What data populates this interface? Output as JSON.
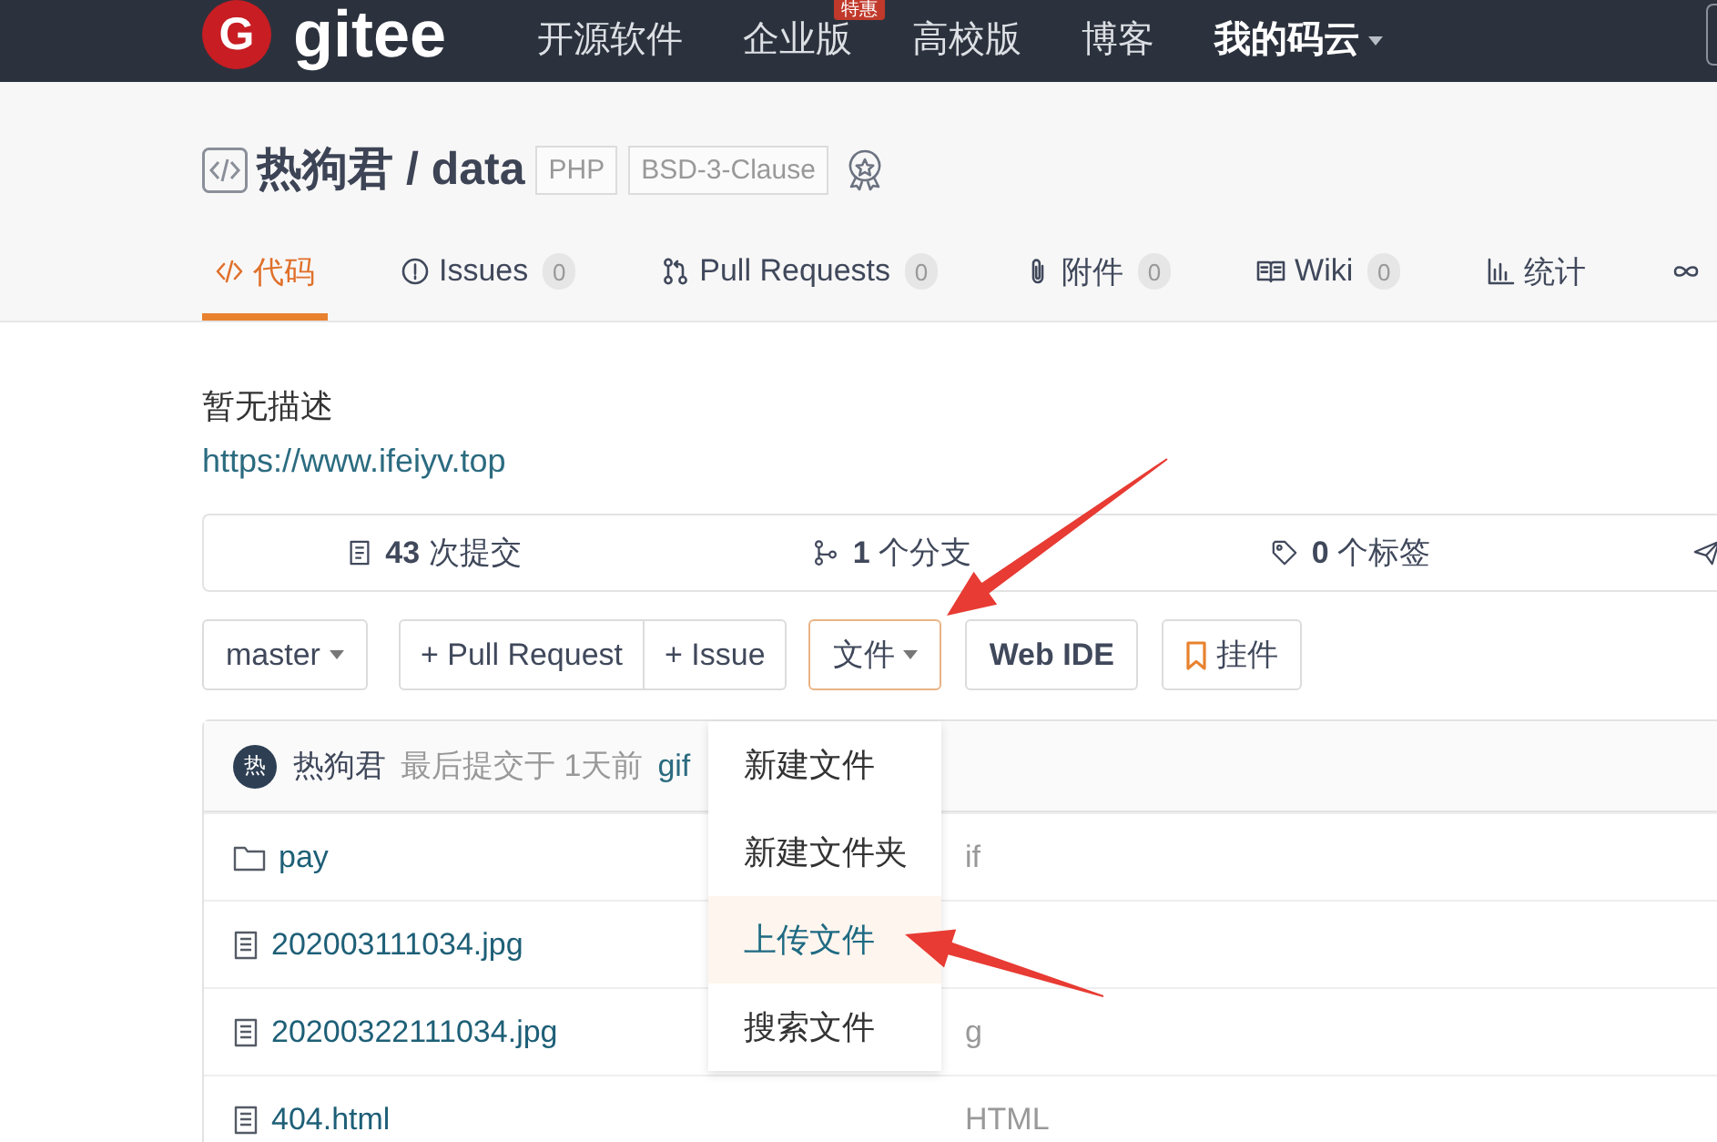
{
  "navbar": {
    "logo": {
      "mark": "G",
      "text": "gitee"
    },
    "items": [
      {
        "label": "开源软件",
        "kind": "link"
      },
      {
        "label": "企业版",
        "kind": "link",
        "badge": "特惠"
      },
      {
        "label": "高校版",
        "kind": "link"
      },
      {
        "label": "博客",
        "kind": "link"
      },
      {
        "label": "我的码云",
        "kind": "menu"
      }
    ]
  },
  "repo": {
    "title": "热狗君 / data",
    "tags": [
      "PHP",
      "BSD-3-Clause"
    ]
  },
  "tabs": [
    {
      "kind": "code",
      "label": "代码",
      "selected": true
    },
    {
      "kind": "issue",
      "label": "Issues",
      "count": "0",
      "selected": false
    },
    {
      "kind": "pull",
      "label": "Pull Requests",
      "count": "0",
      "selected": false
    },
    {
      "kind": "attach",
      "label": "附件",
      "count": "0",
      "selected": false
    },
    {
      "kind": "wiki",
      "label": "Wiki",
      "count": "0",
      "selected": false
    },
    {
      "kind": "chart",
      "label": "统计",
      "selected": false
    },
    {
      "kind": "service",
      "selected": false
    }
  ],
  "description": "暂无描述",
  "homepage": "https://www.ifeiyv.top",
  "stats": [
    {
      "kind": "commit",
      "count": "43",
      "label": "次提交"
    },
    {
      "kind": "branch",
      "count": "1",
      "label": "个分支"
    },
    {
      "kind": "tag",
      "count": "0",
      "label": "个标签"
    },
    {
      "kind": "release"
    }
  ],
  "toolbar": {
    "branch": "master",
    "actions": [
      "+ Pull Request",
      "+ Issue"
    ],
    "file_menu": {
      "label": "文件",
      "expanded": true,
      "items": [
        {
          "label": "新建文件",
          "selected": false
        },
        {
          "label": "新建文件夹",
          "selected": false
        },
        {
          "label": "上传文件",
          "selected": true
        },
        {
          "label": "搜索文件",
          "selected": false
        }
      ]
    },
    "web_ide": "Web IDE",
    "widget": "挂件"
  },
  "files": {
    "last_commit": {
      "avatar": "热",
      "author": "热狗君",
      "info": "最后提交于 1天前",
      "message": "gif"
    },
    "rows": [
      {
        "kind": "folder",
        "name": "pay",
        "message": "if"
      },
      {
        "kind": "file",
        "name": "202003111034.jpg"
      },
      {
        "kind": "file",
        "name": "20200322111034.jpg",
        "message": "g"
      },
      {
        "kind": "file",
        "name": "404.html",
        "message": "HTML"
      }
    ]
  }
}
